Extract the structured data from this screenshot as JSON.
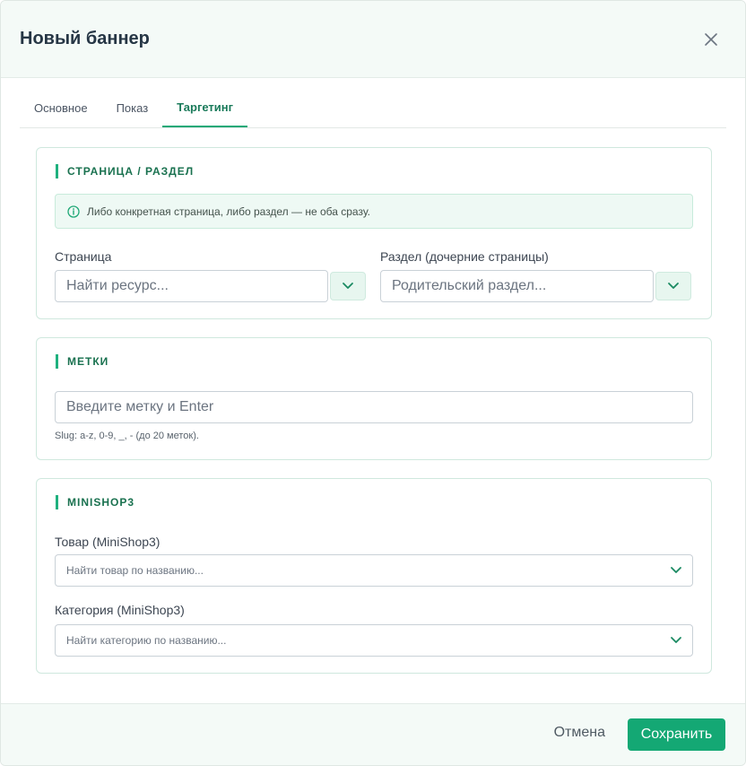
{
  "dialog": {
    "title": "Новый баннер"
  },
  "tabs": [
    {
      "label": "Основное",
      "active": false
    },
    {
      "label": "Показ",
      "active": false
    },
    {
      "label": "Таргетинг",
      "active": true
    }
  ],
  "page_section": {
    "title": "СТРАНИЦА / РАЗДЕЛ",
    "info": "Либо конкретная страница, либо раздел — не оба сразу.",
    "page": {
      "label": "Страница",
      "placeholder": "Найти ресурс..."
    },
    "parent": {
      "label": "Раздел (дочерние страницы)",
      "placeholder": "Родительский раздел..."
    }
  },
  "tags_section": {
    "title": "МЕТКИ",
    "input_placeholder": "Введите метку и Enter",
    "hint": "Slug: a-z, 0-9, _, - (до 20 меток)."
  },
  "minishop_section": {
    "title": "MINISHOP3",
    "product": {
      "label": "Товар (MiniShop3)",
      "placeholder": "Найти товар по названию..."
    },
    "category": {
      "label": "Категория (MiniShop3)",
      "placeholder": "Найти категорию по названию..."
    }
  },
  "footer": {
    "cancel_label": "Отмена",
    "save_label": "Сохранить"
  },
  "colors": {
    "accent": "#14a874",
    "accent_text": "#19714f",
    "header_bg": "#f4faf7"
  },
  "icons": {
    "close": "close-icon",
    "info": "info-icon",
    "chevron": "chevron-down-icon"
  }
}
